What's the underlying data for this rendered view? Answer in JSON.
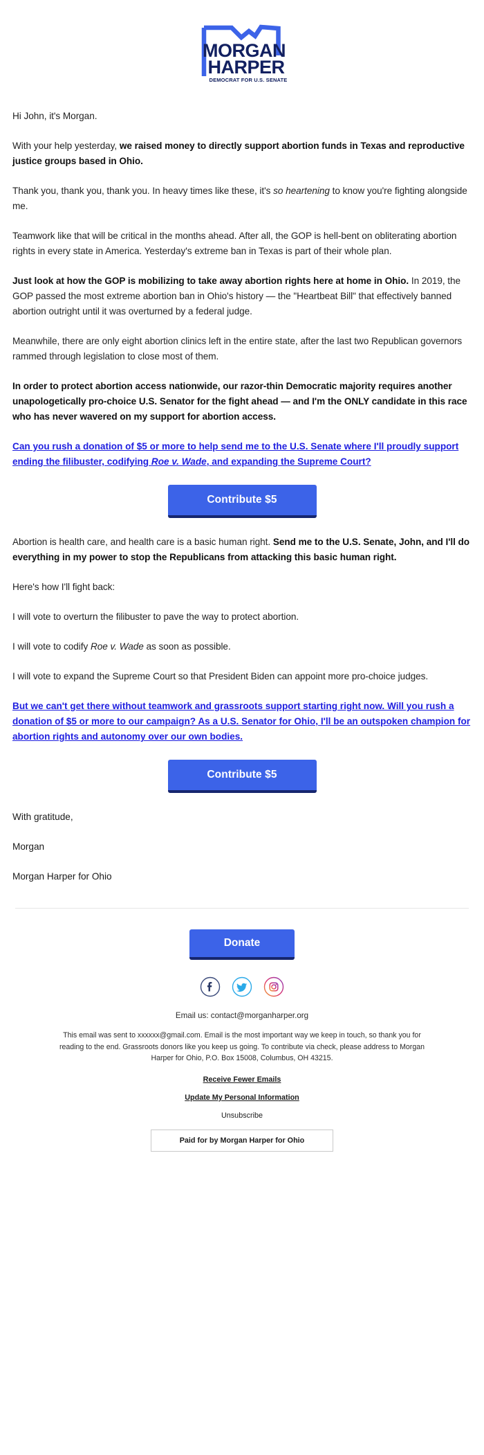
{
  "logo": {
    "name_line1": "MORGAN",
    "name_line2": "HARPER",
    "tagline": "DEMOCRAT FOR U.S. SENATE",
    "outline_color": "#3c63e8",
    "text_color": "#122060"
  },
  "email": {
    "greeting": "Hi John, it's Morgan.",
    "p1_lead": "With your help yesterday, ",
    "p1_bold": "we raised money to directly support abortion funds in Texas and reproductive justice groups based in Ohio.",
    "p2_a": "Thank you, thank you, thank you. In heavy times like these, it's ",
    "p2_italic": "so heartening",
    "p2_b": " to know you're fighting alongside me.",
    "p3": "Teamwork like that will be critical in the months ahead. After all, the GOP is hell-bent on obliterating abortion rights in every state in America. Yesterday's extreme ban in Texas is part of their whole plan.",
    "p4_bold": "Just look at how the GOP is mobilizing to take away abortion rights here at home in Ohio.",
    "p4_rest": " In 2019, the GOP passed the most extreme abortion ban in Ohio's history — the \"Heartbeat Bill\" that effectively banned abortion outright until it was overturned by a federal judge.",
    "p5": "Meanwhile, there are only eight abortion clinics left in the entire state, after the last two Republican governors rammed through legislation to close most of them.",
    "p6_bold": "In order to protect abortion access nationwide, our razor-thin Democratic majority requires another unapologetically pro-choice U.S. Senator for the fight ahead — and I'm the ONLY candidate in this race who has never wavered on my support for abortion access.",
    "link1_a": "Can you rush a donation of $5 or more to help send me to the U.S. Senate where I'll proudly support ending the filibuster, codifying ",
    "link1_italic": "Roe v. Wade",
    "link1_b": ", and expanding the Supreme Court?",
    "p7_a": "Abortion is health care, and health care is a basic human right. ",
    "p7_bold": "Send me to the U.S. Senate, John, and I'll do everything in my power to stop the Republicans from attacking this basic human right.",
    "p8": "Here's how I'll fight back:",
    "p9": "I will vote to overturn the filibuster to pave the way to protect abortion.",
    "p10_a": "I will vote to codify ",
    "p10_italic": "Roe v. Wade",
    "p10_b": " as soon as possible.",
    "p11": "I will vote to expand the Supreme Court so that President Biden can appoint more pro-choice judges.",
    "link2": "But we can't get there without teamwork and grassroots support starting right now. Will you rush a donation of $5 or more to our campaign? As a U.S. Senator for Ohio, I'll be an outspoken champion for abortion rights and autonomy over our own bodies.",
    "sign_off": "With gratitude,",
    "sign_name": "Morgan",
    "sign_org": "Morgan Harper for Ohio"
  },
  "buttons": {
    "contribute_1": "Contribute $5",
    "contribute_2": "Contribute $5",
    "donate": "Donate",
    "bg_color": "#3c63e8",
    "shadow_color": "#16266e"
  },
  "social": [
    {
      "name": "facebook-icon",
      "glyph": "f",
      "color": "#3a4a7a"
    },
    {
      "name": "twitter-icon",
      "glyph": "twitter",
      "color": "#2aa9e8"
    },
    {
      "name": "instagram-icon",
      "glyph": "instagram",
      "color": "#d6317a"
    }
  ],
  "footer": {
    "email_us": "Email us: contact@morganharper.org",
    "fineprint": "This email was sent to xxxxxx@gmail.com. Email is the most important way we keep in touch, so thank you for reading to the end. Grassroots donors like you keep us going. To contribute via check, please address to Morgan Harper for Ohio, P.O. Box 15008, Columbus, OH 43215.",
    "link_fewer": "Receive Fewer Emails",
    "link_update": "Update My Personal Information",
    "link_unsubscribe": "Unsubscribe",
    "paid_for": "Paid for by Morgan Harper for Ohio"
  }
}
